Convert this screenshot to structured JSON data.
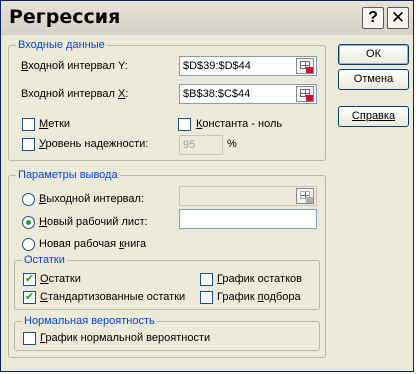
{
  "dialog": {
    "title": "Регрессия",
    "help_glyph": "?",
    "close_glyph": "✕"
  },
  "input_group": {
    "title": "Входные данные",
    "y_label_pre": "",
    "y_label_u": "В",
    "y_label_post": "ходной интервал Y:",
    "y_value": "$D$39:$D$44",
    "x_label_pre": "Входной интервал ",
    "x_label_u": "X",
    "x_label_post": ":",
    "x_value": "$B$38:$C$44",
    "labels_checkbox": {
      "pre": "",
      "u": "М",
      "post": "етки",
      "checked": false
    },
    "constant_checkbox": {
      "pre": "",
      "u": "К",
      "post": "онстанта - ноль",
      "checked": false
    },
    "confidence_checkbox": {
      "pre": "",
      "u": "У",
      "post": "ровень надежности:",
      "checked": false
    },
    "confidence_value": "95",
    "confidence_unit": "%"
  },
  "output_group": {
    "title": "Параметры вывода",
    "output_range": {
      "pre": "",
      "u": "В",
      "post": "ыходной интервал:",
      "selected": false
    },
    "new_sheet": {
      "pre": "",
      "u": "Н",
      "post": "овый рабочий лист:",
      "selected": true
    },
    "new_book": {
      "pre": "Новая рабочая ",
      "u": "к",
      "post": "нига",
      "selected": false
    }
  },
  "residuals_group": {
    "title": "Остатки",
    "residuals": {
      "pre": "",
      "u": "О",
      "post": "статки",
      "checked": true
    },
    "standardized": {
      "pre": "",
      "u": "С",
      "post": "тандартизованные остатки",
      "checked": true
    },
    "residual_plot": {
      "pre": "",
      "u": "Г",
      "post": "рафик остатков",
      "checked": false
    },
    "fit_plot": {
      "pre": "График ",
      "u": "п",
      "post": "одбора",
      "checked": false
    }
  },
  "normal_group": {
    "title": "Нормальная вероятность",
    "normal_plot": {
      "pre": "",
      "u": "Г",
      "post": "рафик нормальной вероятности",
      "checked": false
    }
  },
  "buttons": {
    "ok": "ОК",
    "cancel": "Отмена",
    "help": "Справка"
  },
  "checkmark": "✔"
}
